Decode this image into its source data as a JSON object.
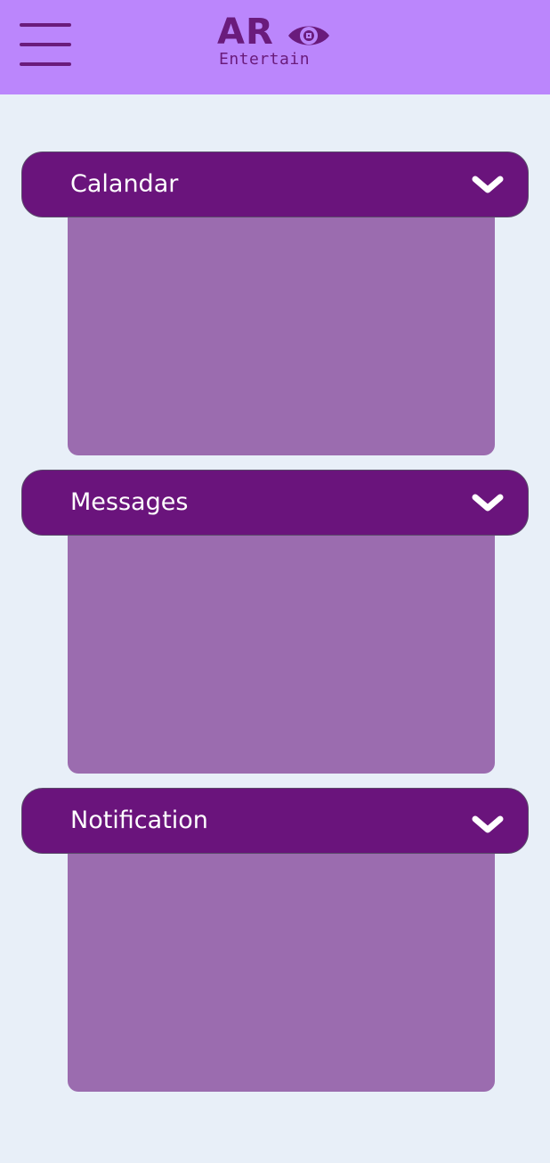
{
  "header": {
    "logo_primary": "AR",
    "logo_secondary": "Entertain",
    "menu_icon": "hamburger-menu-icon",
    "eye_icon": "eye-icon"
  },
  "sections": [
    {
      "title": "Calandar",
      "icon": "chevron-down-icon"
    },
    {
      "title": "Messages",
      "icon": "chevron-down-icon"
    },
    {
      "title": "Notification",
      "icon": "chevron-down-icon"
    }
  ],
  "colors": {
    "header_bg": "#bb86fc",
    "brand": "#6a1b7c",
    "section_header_bg": "#6a147c",
    "panel_bg": "#9b6caf",
    "page_bg": "#e8eff8"
  }
}
